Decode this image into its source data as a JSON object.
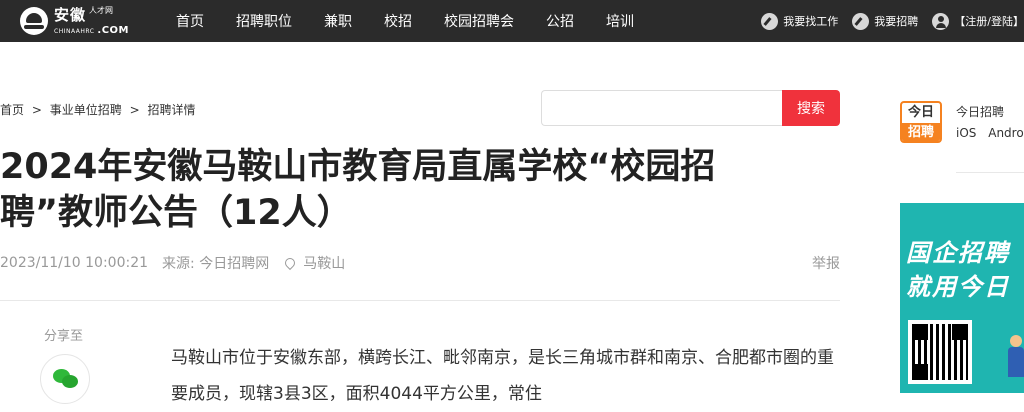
{
  "logo": {
    "main": "安徽",
    "small": "人才网",
    "sub": "CHINAAHRC",
    "com": ".COM"
  },
  "nav": {
    "items": [
      "首页",
      "招聘职位",
      "兼职",
      "校招",
      "校园招聘会",
      "公招",
      "培训"
    ],
    "find_job": "我要找工作",
    "recruit": "我要招聘",
    "login": "【注册/登陆】"
  },
  "breadcrumb": {
    "home": "首页",
    "sep1": ">",
    "category": "事业单位招聘",
    "sep2": ">",
    "current": "招聘详情"
  },
  "search": {
    "placeholder": "",
    "button": "搜索"
  },
  "article": {
    "title": "2024年安徽马鞍山市教育局直属学校“校园招聘”教师公告（12人）",
    "date": "2023/11/10 10:00:21",
    "source": "来源: 今日招聘网",
    "location": "马鞍山",
    "report": "举报",
    "share_label": "分享至",
    "body": "马鞍山市位于安徽东部，横跨长江、毗邻南京，是长三角城市群和南京、合肥都市圈的重要成员，现辖3县3区，面积4044平方公里，常住"
  },
  "sidebar": {
    "app_logo_top": "今日",
    "app_logo_bottom": "招聘",
    "app_name": "今日招聘",
    "platforms": [
      "iOS",
      "Android"
    ],
    "banner_line1": "国企招聘",
    "banner_line2": "就用今日"
  },
  "colors": {
    "topbar": "#2b2b2b",
    "search_button": "#f0323c",
    "brand_orange": "#f58220",
    "banner": "#1fb5b0",
    "wechat": "#2fb83a"
  }
}
